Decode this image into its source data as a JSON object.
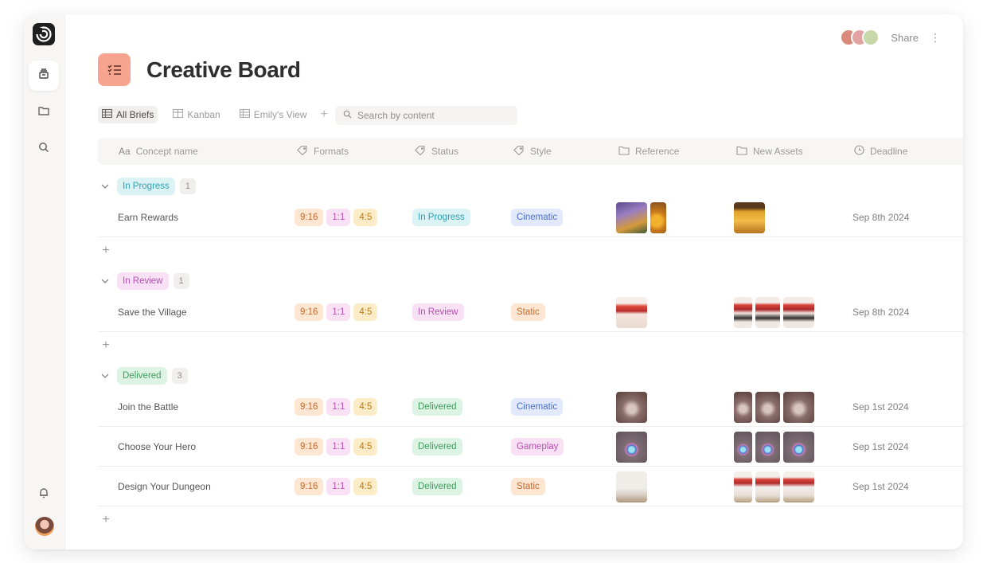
{
  "header": {
    "title": "Creative Board",
    "share_label": "Share"
  },
  "views": [
    {
      "label": "All Briefs",
      "active": true
    },
    {
      "label": "Kanban",
      "active": false
    },
    {
      "label": "Emily's View",
      "active": false
    }
  ],
  "search": {
    "placeholder": "Search by content"
  },
  "columns": {
    "concept": "Concept name",
    "formats": "Formats",
    "status": "Status",
    "style": "Style",
    "reference": "Reference",
    "new_assets": "New Assets",
    "deadline": "Deadline"
  },
  "groups": [
    {
      "label": "In Progress",
      "count": "1",
      "rows": [
        {
          "name": "Earn Rewards",
          "formats": [
            "9:16",
            "1:1",
            "4:5"
          ],
          "status": "In Progress",
          "style": "Cinematic",
          "deadline": "Sep 8th 2024"
        }
      ]
    },
    {
      "label": "In Review",
      "count": "1",
      "rows": [
        {
          "name": "Save the Village",
          "formats": [
            "9:16",
            "1:1",
            "4:5"
          ],
          "status": "In Review",
          "style": "Static",
          "deadline": "Sep 8th 2024"
        }
      ]
    },
    {
      "label": "Delivered",
      "count": "3",
      "rows": [
        {
          "name": "Join the Battle",
          "formats": [
            "9:16",
            "1:1",
            "4:5"
          ],
          "status": "Delivered",
          "style": "Cinematic",
          "deadline": "Sep 1st 2024"
        },
        {
          "name": "Choose Your Hero",
          "formats": [
            "9:16",
            "1:1",
            "4:5"
          ],
          "status": "Delivered",
          "style": "Gameplay",
          "deadline": "Sep 1st 2024"
        },
        {
          "name": "Design Your Dungeon",
          "formats": [
            "9:16",
            "1:1",
            "4:5"
          ],
          "status": "Delivered",
          "style": "Static",
          "deadline": "Sep 1st 2024"
        }
      ]
    }
  ],
  "colors": {
    "title_icon_bg": "#f6a48f",
    "in_progress": "#2f9fb0",
    "in_review": "#b451ad",
    "delivered": "#3f9b5c"
  },
  "icons": {
    "sidebar": [
      "app-logo-icon",
      "board-icon",
      "folder-icon",
      "search-icon",
      "bell-icon"
    ],
    "toolbar": [
      "table-icon",
      "plus-icon",
      "search-icon"
    ],
    "columns": [
      "text-icon",
      "tag-icon",
      "tag-icon",
      "tag-icon",
      "folder-icon",
      "folder-icon",
      "clock-icon"
    ]
  }
}
